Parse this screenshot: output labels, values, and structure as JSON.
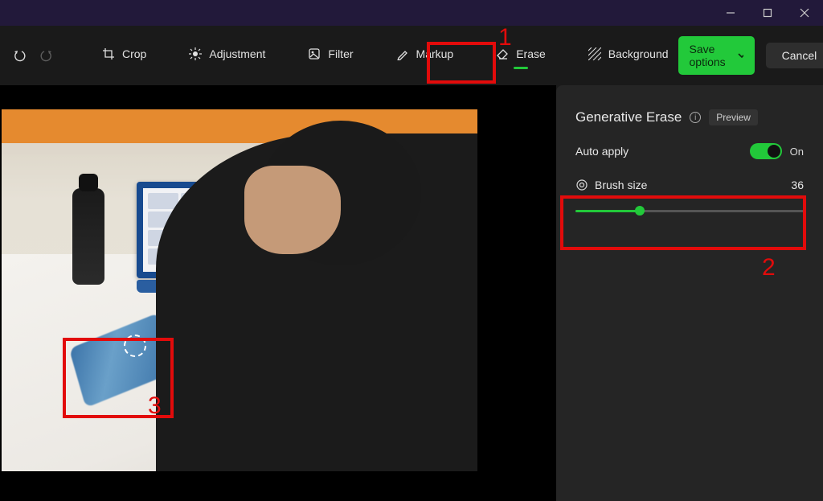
{
  "titlebar": {
    "minimize": "minimize",
    "maximize": "maximize",
    "close": "close"
  },
  "toolbar": {
    "undo": "Undo",
    "redo": "Redo",
    "tools": [
      {
        "key": "crop",
        "label": "Crop"
      },
      {
        "key": "adjustment",
        "label": "Adjustment"
      },
      {
        "key": "filter",
        "label": "Filter"
      },
      {
        "key": "markup",
        "label": "Markup"
      },
      {
        "key": "erase",
        "label": "Erase",
        "active": true
      },
      {
        "key": "background",
        "label": "Background"
      }
    ],
    "save_label": "Save options",
    "cancel_label": "Cancel"
  },
  "panel": {
    "title": "Generative Erase",
    "preview_badge": "Preview",
    "auto_apply_label": "Auto apply",
    "auto_apply_state": "On",
    "brush_label": "Brush size",
    "brush_value": "36",
    "brush_percent": 28
  },
  "annotations": {
    "one": "1",
    "two": "2",
    "three": "3"
  }
}
